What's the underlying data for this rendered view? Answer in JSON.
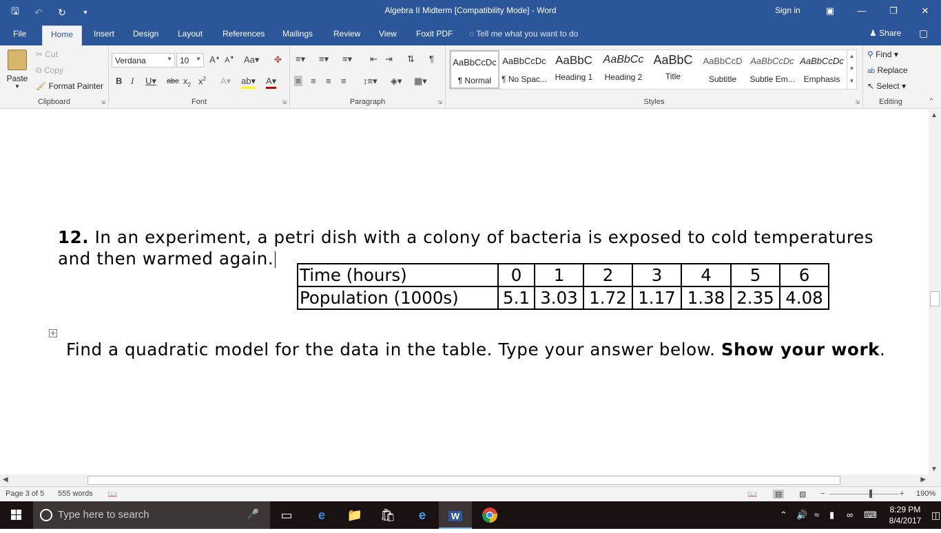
{
  "titlebar": {
    "title": "Algebra II Midterm [Compatibility Mode]  -  Word",
    "sign_in": "Sign in"
  },
  "tabs": [
    "File",
    "Home",
    "Insert",
    "Design",
    "Layout",
    "References",
    "Mailings",
    "Review",
    "View",
    "Foxit PDF"
  ],
  "active_tab": "Home",
  "tell_me": "Tell me what you want to do",
  "share": "Share",
  "ribbon": {
    "clipboard": {
      "label": "Clipboard",
      "paste": "Paste",
      "cut": "Cut",
      "copy": "Copy",
      "format_painter": "Format Painter"
    },
    "font": {
      "label": "Font",
      "font_name": "Verdana",
      "font_size": "10"
    },
    "paragraph": {
      "label": "Paragraph"
    },
    "styles": {
      "label": "Styles",
      "items": [
        {
          "preview": "AaBbCcDc",
          "name": "¶ Normal"
        },
        {
          "preview": "AaBbCcDc",
          "name": "¶ No Spac..."
        },
        {
          "preview": "AaBbC",
          "name": "Heading 1"
        },
        {
          "preview": "AaBbCc",
          "name": "Heading 2"
        },
        {
          "preview": "AaBbC",
          "name": "Title"
        },
        {
          "preview": "AaBbCcD",
          "name": "Subtitle"
        },
        {
          "preview": "AaBbCcDc",
          "name": "Subtle Em..."
        },
        {
          "preview": "AaBbCcDc",
          "name": "Emphasis"
        }
      ]
    },
    "editing": {
      "label": "Editing",
      "find": "Find",
      "replace": "Replace",
      "select": "Select"
    }
  },
  "document": {
    "question_number": "12.",
    "question_text": "In an experiment, a petri dish with a colony of bacteria is exposed to cold temperatures and then warmed again.",
    "table": {
      "row1_header": "Time (hours)",
      "row1": [
        "0",
        "1",
        "2",
        "3",
        "4",
        "5",
        "6"
      ],
      "row2_header": "Population (1000s)",
      "row2": [
        "5.1",
        "3.03",
        "1.72",
        "1.17",
        "1.38",
        "2.35",
        "4.08"
      ]
    },
    "instruction": "Find a quadratic model for the data in the table. Type your answer below.",
    "instruction_bold": "Show your work",
    "instruction_end": "."
  },
  "status": {
    "page": "Page 3 of 5",
    "words": "555 words",
    "zoom": "190%"
  },
  "taskbar": {
    "search_placeholder": "Type here to search",
    "time": "8:29 PM",
    "date": "8/4/2017"
  }
}
